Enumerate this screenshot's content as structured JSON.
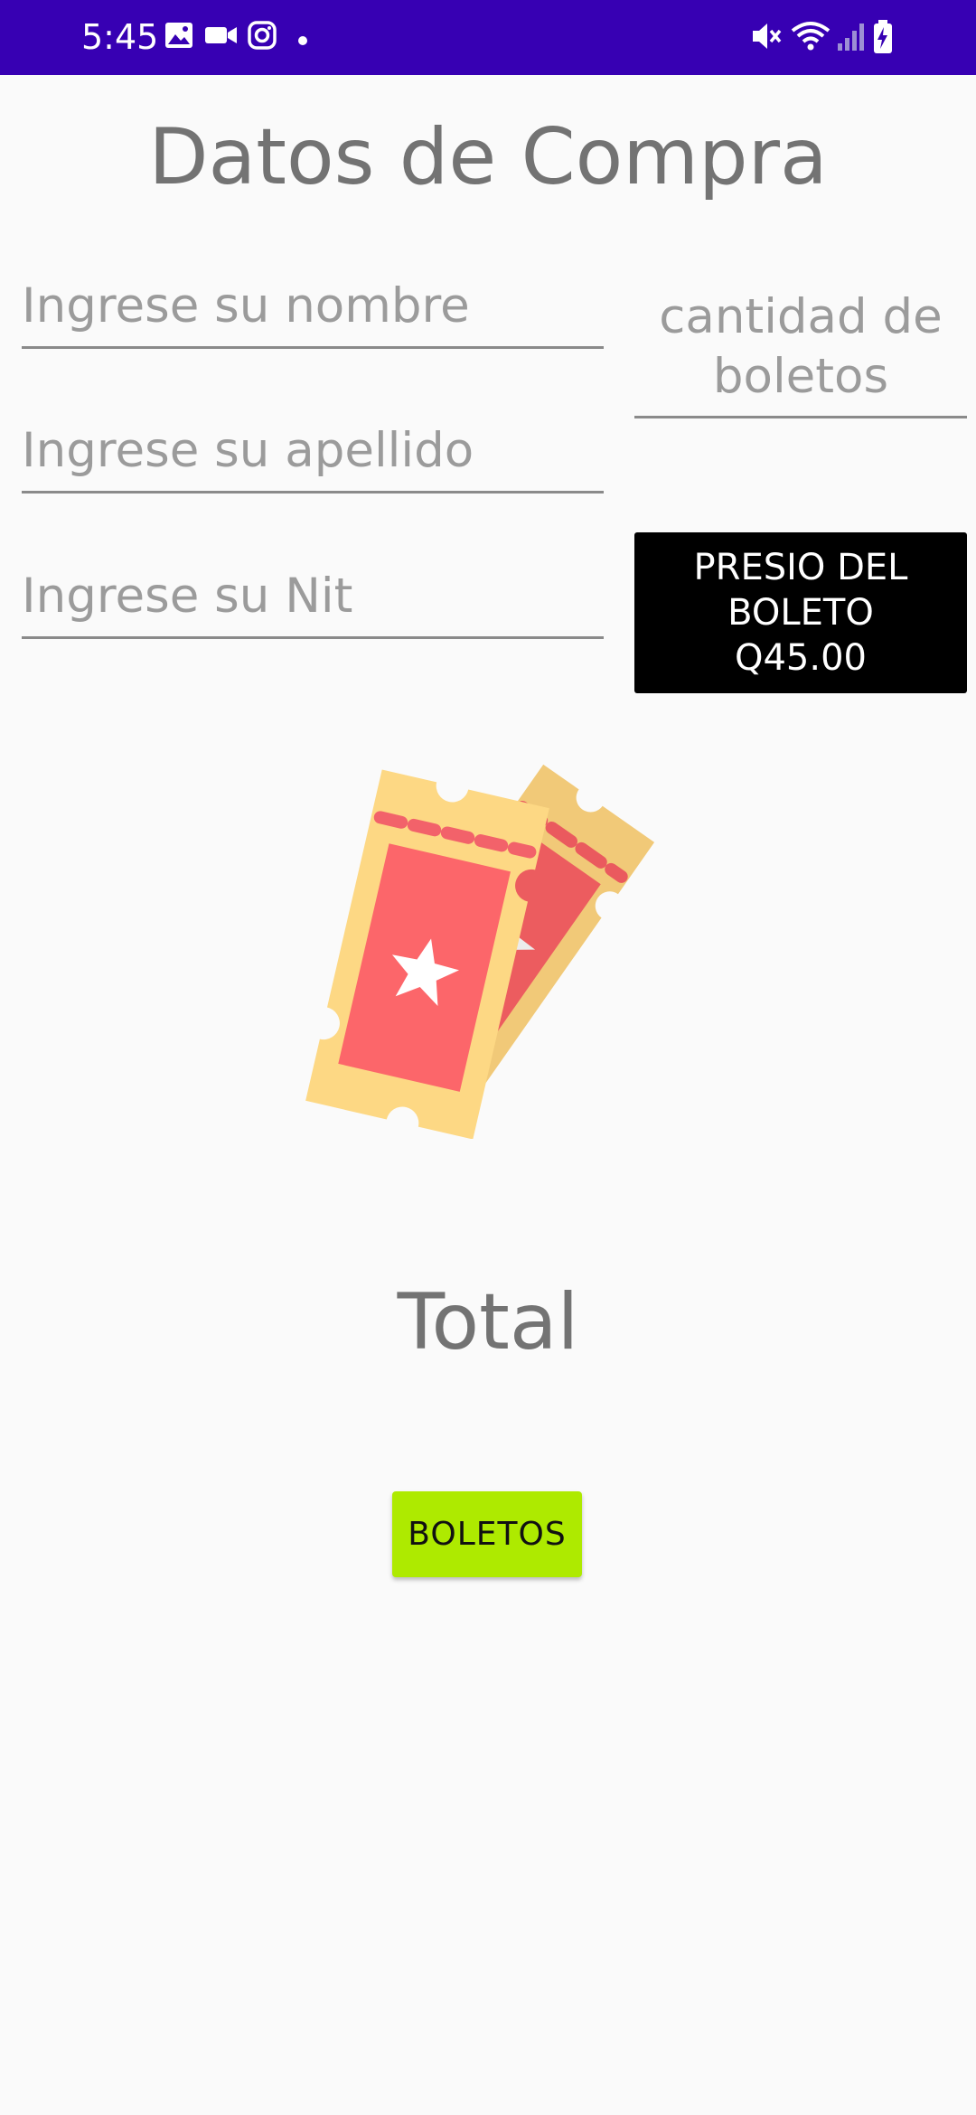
{
  "status_bar": {
    "time": "5:45",
    "background_color": "#3700b3",
    "left_icons": [
      "image-icon",
      "video-camera-icon",
      "instagram-icon",
      "notification-dot-icon"
    ],
    "right_icons": [
      "mute-icon",
      "wifi-icon",
      "signal-icon",
      "battery-charging-icon"
    ]
  },
  "page": {
    "title": "Datos de Compra"
  },
  "form": {
    "nombre_placeholder": "Ingrese su nombre",
    "apellido_placeholder": "Ingrese su apellido",
    "nit_placeholder": "Ingrese su Nit",
    "cantidad_placeholder": "cantidad de boletos"
  },
  "price_box": {
    "line1": "PRESIO DEL",
    "line2": "BOLETO",
    "line3": "Q45.00",
    "background_color": "#000000"
  },
  "image": {
    "icon": "tickets-icon"
  },
  "total": {
    "label": "Total"
  },
  "button": {
    "label": "BOLETOS",
    "background_color": "#aeea00"
  }
}
